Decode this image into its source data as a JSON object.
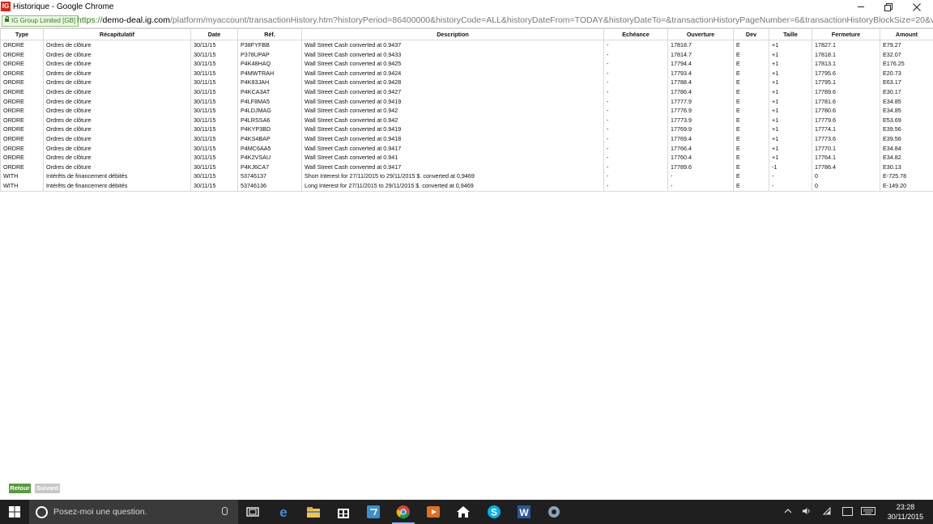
{
  "window": {
    "logo_text": "IG",
    "title": "Historique - Google Chrome"
  },
  "address_bar": {
    "ev_label": "IG Group Limited [GB]",
    "url_scheme": "https://",
    "url_host": "demo-deal.ig.com",
    "url_path": "/platform/myaccount/transactionHistory.htm?historyPeriod=86400000&historyCode=ALL&historyDateFrom=TODAY&historyDateTo=&transactionHistoryPageNumber=6&transactionHistoryBlockSize=20&view=&bundleNam"
  },
  "table": {
    "columns": [
      "Type",
      "Récapitulatif",
      "Date",
      "Réf.",
      "Description",
      "Echéance",
      "Ouverture",
      "Dev",
      "Taille",
      "Fermeture",
      "Amount"
    ],
    "rows": [
      [
        "ORDRE",
        "Ordres de clôture",
        "30/11/15",
        "P38FYFBB",
        "Wall Street Cash converted at 0.9437",
        "-",
        "17818.7",
        "E",
        "+1",
        "17827.1",
        "E79.27"
      ],
      [
        "ORDRE",
        "Ordres de clôture",
        "30/11/15",
        "P378UPAP",
        "Wall Street Cash converted at 0.9433",
        "-",
        "17814.7",
        "E",
        "+1",
        "17818.1",
        "E32.07"
      ],
      [
        "ORDRE",
        "Ordres de clôture",
        "30/11/15",
        "P4K48HAQ",
        "Wall Street Cash converted at 0.9425",
        "-",
        "17794.4",
        "E",
        "+1",
        "17813.1",
        "E176.25"
      ],
      [
        "ORDRE",
        "Ordres de clôture",
        "30/11/15",
        "P4MWTRAH",
        "Wall Street Cash converted at 0.9424",
        "-",
        "17793.4",
        "E",
        "+1",
        "17795.6",
        "E20.73"
      ],
      [
        "ORDRE",
        "Ordres de clôture",
        "30/11/15",
        "P4K83JAH",
        "Wall Street Cash converted at 0.9428",
        "-",
        "17788.4",
        "E",
        "+1",
        "17795.1",
        "E63.17"
      ],
      [
        "ORDRE",
        "Ordres de clôture",
        "30/11/15",
        "P4KCA3AT",
        "Wall Street Cash converted at 0.9427",
        "-",
        "17786.4",
        "E",
        "+1",
        "17789.6",
        "E30.17"
      ],
      [
        "ORDRE",
        "Ordres de clôture",
        "30/11/15",
        "P4LF8MA5",
        "Wall Street Cash converted at 0.9419",
        "-",
        "17777.9",
        "E",
        "+1",
        "17781.6",
        "E34.85"
      ],
      [
        "ORDRE",
        "Ordres de clôture",
        "30/11/15",
        "P4LDJMAG",
        "Wall Street Cash converted at 0.942",
        "-",
        "17776.9",
        "E",
        "+1",
        "17780.6",
        "E34.85"
      ],
      [
        "ORDRE",
        "Ordres de clôture",
        "30/11/15",
        "P4LRSSA6",
        "Wall Street Cash converted at 0.942",
        "-",
        "17773.9",
        "E",
        "+1",
        "17779.6",
        "E53.69"
      ],
      [
        "ORDRE",
        "Ordres de clôture",
        "30/11/15",
        "P4KYP3BD",
        "Wall Street Cash converted at 0.9419",
        "-",
        "17769.9",
        "E",
        "+1",
        "17774.1",
        "E39.56"
      ],
      [
        "ORDRE",
        "Ordres de clôture",
        "30/11/15",
        "P4KS4BAP",
        "Wall Street Cash converted at 0.9418",
        "-",
        "17769.4",
        "E",
        "+1",
        "17773.6",
        "E39.56"
      ],
      [
        "ORDRE",
        "Ordres de clôture",
        "30/11/15",
        "P4MC6AA5",
        "Wall Street Cash converted at 0.9417",
        "-",
        "17766.4",
        "E",
        "+1",
        "17770.1",
        "E34.84"
      ],
      [
        "ORDRE",
        "Ordres de clôture",
        "30/11/15",
        "P4K2VSAU",
        "Wall Street Cash converted at 0.941",
        "-",
        "17760.4",
        "E",
        "+1",
        "17764.1",
        "E34.82"
      ],
      [
        "ORDRE",
        "Ordres de clôture",
        "30/11/15",
        "P4KJ6CA7",
        "Wall Street Cash converted at 0.9417",
        "-",
        "17789.6",
        "E",
        "-1",
        "17786.4",
        "E30.13"
      ],
      [
        "WITH",
        "Intérêts de financement débités",
        "30/11/15",
        "53746137",
        "Short Interest for 27/11/2015 to 29/11/2015 $. converted at 0,9469",
        "-",
        "-",
        "E",
        "-",
        "0",
        "E-725.78"
      ],
      [
        "WITH",
        "Intérêts de financement débités",
        "30/11/15",
        "53746136",
        "Long Interest for 27/11/2015 to 29/11/2015 $. converted at 0,9469",
        "-",
        "-",
        "E",
        "-",
        "0",
        "E-149.20"
      ]
    ]
  },
  "pagination": {
    "back_label": "Retour",
    "next_label": "Suivant"
  },
  "taskbar": {
    "search_placeholder": "Posez-moi une question.",
    "time": "23:28",
    "date": "30/11/2015"
  },
  "colors": {
    "accent_green": "#5a9a3c",
    "brand_red": "#e2231a",
    "taskbar": "#1f1f1f"
  }
}
